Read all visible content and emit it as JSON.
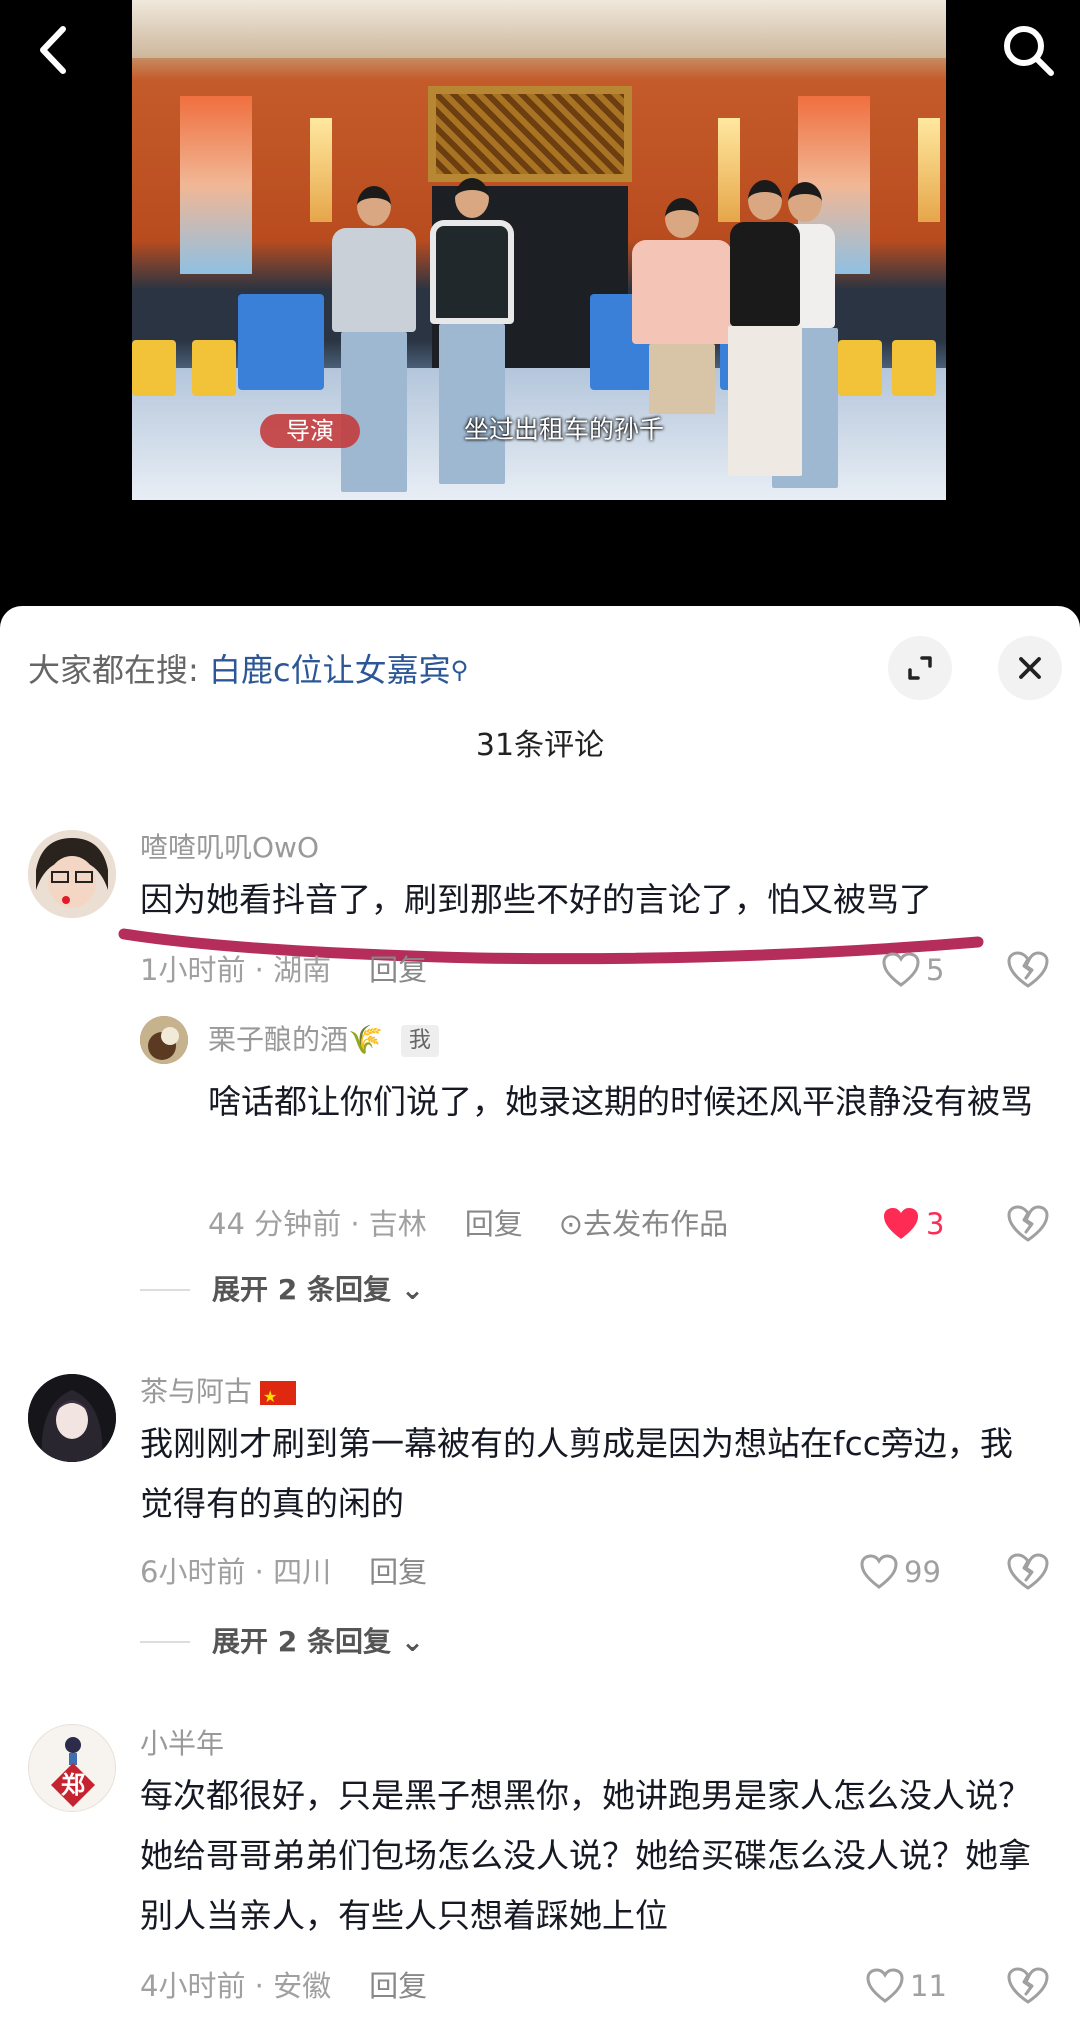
{
  "video": {
    "caption_tag": "导演",
    "subtitle": "坐过出租车的孙千"
  },
  "search_suggest": {
    "label": "大家都在搜: ",
    "keyword": "白鹿c位让女嘉宾",
    "icon": "search-icon"
  },
  "comments_header": {
    "count_label": "31条评论"
  },
  "comments": [
    {
      "user": "喳喳叽叽OwO",
      "text": "因为她看抖音了，刷到那些不好的言论了，怕又被骂了",
      "time_location": "1小时前 · 湖南",
      "reply_label": "回复",
      "likes": "5",
      "liked": false
    },
    {
      "user": "茶与阿古",
      "text": "我刚刚才刷到第一幕被有的人剪成是因为想站在fcc旁边，我觉得有的真的闲的",
      "time_location": "6小时前 · 四川",
      "reply_label": "回复",
      "likes": "99",
      "liked": false
    },
    {
      "user": "小半年",
      "avatar_char": "郑",
      "text": "每次都很好，只是黑子想黑你，她讲跑男是家人怎么没人说？她给哥哥弟弟们包场怎么没人说？她给买碟怎么没人说？她拿别人当亲人，有些人只想着踩她上位",
      "time_location": "4小时前 · 安徽",
      "reply_label": "回复",
      "likes": "11",
      "liked": false
    }
  ],
  "reply": {
    "user": "栗子酿的酒🌾",
    "badge": "我",
    "text": "啥话都让你们说了，她录这期的时候还风平浪静没有被骂",
    "time_location": "44 分钟前 · 吉林",
    "reply_label": "回复",
    "publish_label": "去发布作品",
    "likes": "3",
    "liked": true
  },
  "expand_replies": [
    "展开 2 条回复",
    "展开 2 条回复"
  ],
  "colors": {
    "like_red": "#fe2c55",
    "keyword_blue": "#2b5797",
    "highlight_stroke": "#b52d5a"
  }
}
